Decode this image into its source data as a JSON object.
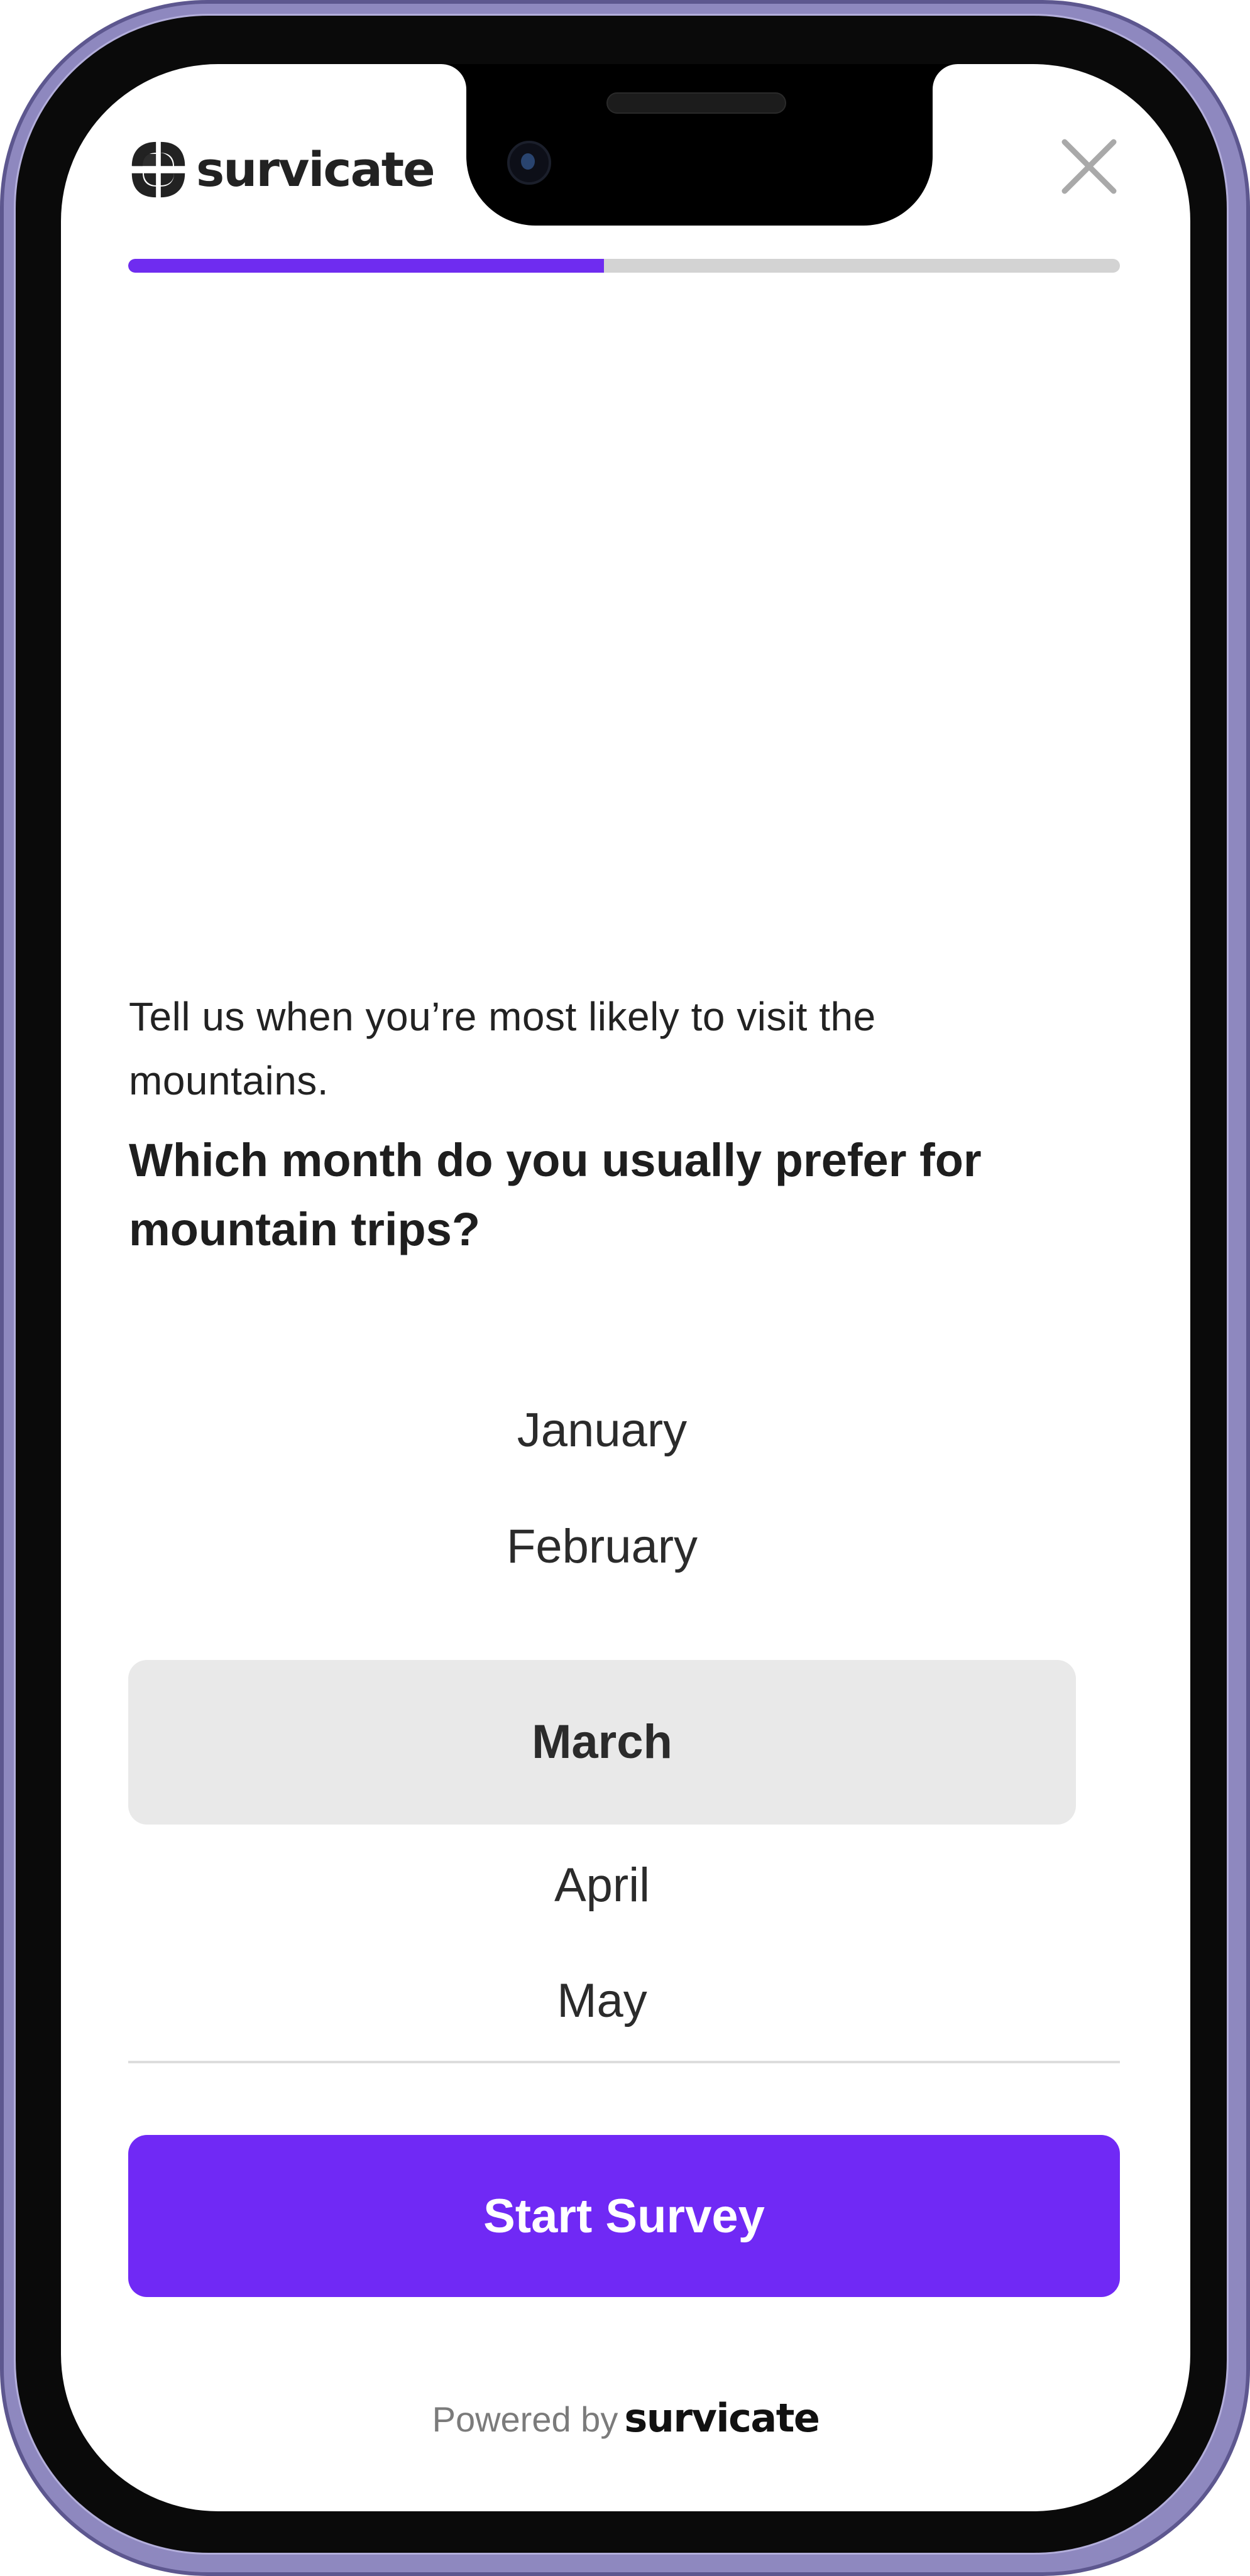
{
  "brand": {
    "name": "survicate"
  },
  "close_icon": "close-icon",
  "progress": {
    "fraction": 0.48,
    "fill_color": "#6f2cf0",
    "track_color": "#d3d3d3"
  },
  "survey": {
    "intro": "Tell us when you’re most likely to visit the mountains.",
    "question": "Which month do you usually prefer for mountain trips?",
    "options": [
      "January",
      "February",
      "March",
      "April",
      "May"
    ],
    "selected": "March"
  },
  "footer": {
    "start_label": "Start Survey",
    "powered_by": "Powered by",
    "powered_brand": "survicate"
  },
  "colors": {
    "accent": "#7029f5",
    "selected_bg": "#e9e9e9"
  }
}
